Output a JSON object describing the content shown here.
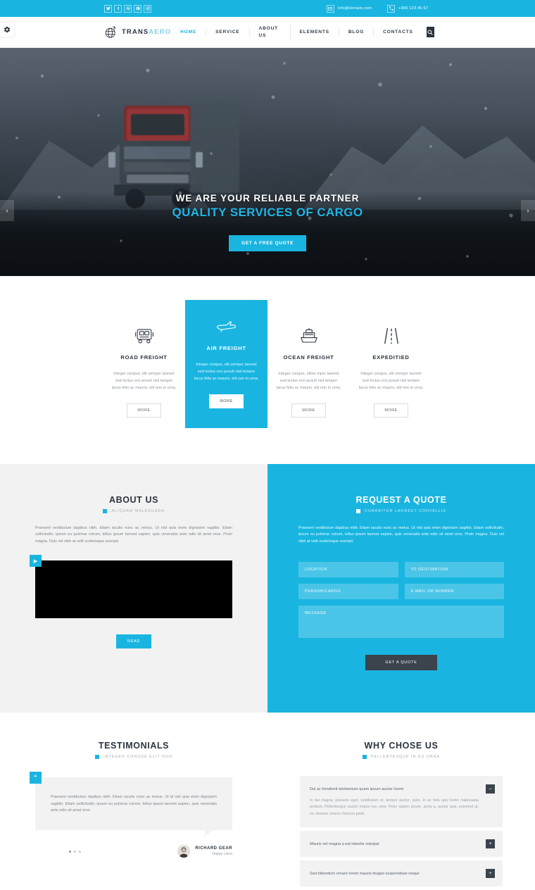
{
  "topbar": {
    "social": [
      {
        "name": "twitter-icon",
        "glyph": "t"
      },
      {
        "name": "facebook-icon",
        "glyph": "f"
      },
      {
        "name": "dribbble-icon",
        "glyph": "d"
      },
      {
        "name": "pinterest-icon",
        "glyph": "p"
      },
      {
        "name": "instagram-icon",
        "glyph": "i"
      }
    ],
    "email": "info@domain.com",
    "phone": "+900 123 45 67"
  },
  "header": {
    "logo_main": "TRANS",
    "logo_accent": "AERO",
    "nav": [
      {
        "label": "HOME",
        "active": true
      },
      {
        "label": "SERVICE",
        "active": false
      },
      {
        "label": "ABOUT US",
        "active": false
      },
      {
        "label": "ELEMENTS",
        "active": false
      },
      {
        "label": "BLOG",
        "active": false
      },
      {
        "label": "CONTACTS",
        "active": false
      }
    ]
  },
  "hero": {
    "subtitle": "WE ARE YOUR RELIABLE PARTNER",
    "title": "QUALITY SERVICES OF CARGO",
    "cta": "GET A FREE QUOTE",
    "prev": "‹",
    "next": "›"
  },
  "services": {
    "more_label": "MORE",
    "items": [
      {
        "icon": "truck-icon",
        "title": "ROAD FREIGHT",
        "text": "Integer congue, elit semper laoreet sed lectus orci posuh nisl tempor lacus felis ac mauris, elit non in urna.",
        "featured": false
      },
      {
        "icon": "airplane-icon",
        "title": "AIR FREIGHT",
        "text": "Integer congue, elit semper laoreet sed lectus orci posuh nisl tempor lacus felis ac mauris, elit non in urna.",
        "featured": true
      },
      {
        "icon": "ship-icon",
        "title": "OCEAN FREIGHT",
        "text": "Integer congue, elitse mper laoreet sed lectus orci posuh nisl tempor lacus felis ac mauris, elit non in urna.",
        "featured": false
      },
      {
        "icon": "road-icon",
        "title": "EXPEDITIED",
        "text": "Integer congue, elit semper laoreet sed lectus orci posuh nisl tempor lacus felis ac mauris, elit non in urna.",
        "featured": false
      }
    ]
  },
  "about": {
    "title": "ABOUT US",
    "subtitle": "ALIQUAM MALESUADA",
    "text": "Praesent vestibulum dapibus nibh. Etiam iaculis nunc ac metus. Ut nisl quis enim dignissim sagittis. Etiam sollicitudin, ipsum eu pulvinar rutrum, tellus ipsum laoreet sapien, quis venenatis ante odio sit amet eros. Proin magna. Duis vel nibh at velit scelerisque suscipit.",
    "read_label": "READ",
    "play_label": "▶"
  },
  "quote": {
    "title": "REQUEST A QUOTE",
    "subtitle": "CURABITUR LAOREET CONVALLIS",
    "text": "Praesent vestibulum dapibus nibh. Etiam iaculis nunc ac metus. Ut nisl quis enim dignissim sagittis. Etiam sollicitudin, ipsum eu pulvinar rutrum, tellus ipsum laoreet sapien, quis venenatis ante odio sit amet eros. Proin magna. Duis vel nibh at velit scelerisque suscipit.",
    "f_location": "LOCATION",
    "f_destination": "TO DESTINATION",
    "f_person": "PERSON/CARGO",
    "f_email": "E-MAIL OR NUMBER",
    "f_message": "MESSAGE",
    "submit": "GET A QUOTE"
  },
  "testimonials": {
    "title": "TESTIMONIALS",
    "subtitle": "INTEGER CONGUE ELIT NON",
    "quote_mark": "“",
    "text": "Praesent vestibulum dapibus nibh. Etiam iaculis nunc ac metus. Ut id nisl quis enim dignissim sagittis. Etiam sollicitudin, ipsum eu pulvinar rutrum, tellus ipsum laoreet sapien, quis venenatis ante odio sit amet eros.",
    "author": "RICHARD GEAR",
    "role": "Happy client"
  },
  "why": {
    "title": "WHY CHOSE US",
    "subtitle": "PELLENTESQUE IN EU URNA",
    "items": [
      {
        "title": "Dui ac hendrerit elementum quam ipsum auctor lorem",
        "body": "In dui magna, posuere eget, vestibulum et, tempor auctor, justo. In ac felis quis tortor malesuada pretium. Pellentesque auctor neque nec urna. Proin sapien ipsum, porta a, auctor quis, euismod ut, mi. Aenean viverra rhoncus pede.",
        "open": true,
        "toggle": "–"
      },
      {
        "title": "Mauris vel magna a est lobortis volutpat",
        "body": "",
        "open": false,
        "toggle": "+"
      },
      {
        "title": "Sed bibendum ornare lorem mauris feugiat suspendisse neque",
        "body": "",
        "open": false,
        "toggle": "+"
      }
    ]
  },
  "colors": {
    "accent": "#19b5e0",
    "dark": "#2b3440",
    "muted": "#8d959d",
    "light_bg": "#f2f2f2"
  }
}
